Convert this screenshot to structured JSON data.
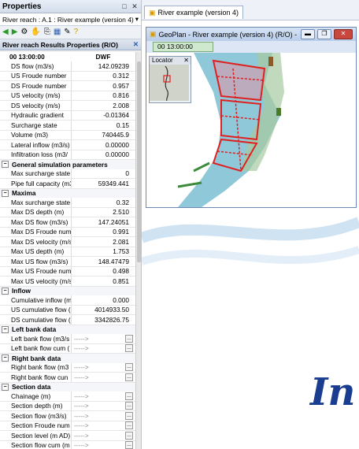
{
  "panel": {
    "title": "Properties",
    "pin": "□",
    "close": "✕",
    "object": "River reach : A.1 : River example (version 4)",
    "results_title": "River reach Results Properties (R/O)"
  },
  "toolbar_icons": [
    "back-arrow-icon",
    "forward-arrow-icon",
    "settings-icon",
    "pointer-icon",
    "copy-icon",
    "grid-icon",
    "paint-icon",
    "help-icon"
  ],
  "grid": {
    "time": "00 13:00:00",
    "scenario": "DWF"
  },
  "rows_top": [
    {
      "name": "DS flow (m3/s)",
      "value": "142.09239"
    },
    {
      "name": "US Froude number",
      "value": "0.312"
    },
    {
      "name": "DS Froude number",
      "value": "0.957"
    },
    {
      "name": "US velocity (m/s)",
      "value": "0.816"
    },
    {
      "name": "DS velocity (m/s)",
      "value": "2.008"
    },
    {
      "name": "Hydraulic gradient",
      "value": "-0.01364"
    },
    {
      "name": "Surcharge state",
      "value": "0.15"
    },
    {
      "name": "Volume (m3)",
      "value": "740445.9"
    },
    {
      "name": "Lateral inflow (m3/s)",
      "value": "0.00000"
    },
    {
      "name": "Infiltration loss (m3/",
      "value": "0.00000"
    }
  ],
  "sections": [
    {
      "title": "General simulation parameters",
      "rows": [
        {
          "name": "Max surcharge state",
          "value": "0"
        },
        {
          "name": "Pipe full capacity (m3",
          "value": "59349.441"
        }
      ]
    },
    {
      "title": "Maxima",
      "rows": [
        {
          "name": "Max surcharge state",
          "value": "0.32"
        },
        {
          "name": "Max DS depth (m)",
          "value": "2.510"
        },
        {
          "name": "Max DS flow (m3/s)",
          "value": "147.24051"
        },
        {
          "name": "Max DS Froude num",
          "value": "0.991"
        },
        {
          "name": "Max DS velocity (m/s",
          "value": "2.081"
        },
        {
          "name": "Max US depth (m)",
          "value": "1.753"
        },
        {
          "name": "Max US flow (m3/s)",
          "value": "148.47479"
        },
        {
          "name": "Max US Froude num",
          "value": "0.498"
        },
        {
          "name": "Max US velocity (m/s",
          "value": "0.851"
        }
      ]
    },
    {
      "title": "Inflow",
      "rows": [
        {
          "name": "Cumulative inflow (m",
          "value": "0.000"
        },
        {
          "name": "US cumulative flow (",
          "value": "4014933.50"
        },
        {
          "name": "DS cumulative flow (",
          "value": "3342826.75"
        }
      ]
    },
    {
      "title": "Left bank data",
      "rows": [
        {
          "name": "Left bank flow (m3/s",
          "value": "----->",
          "empty": true
        },
        {
          "name": "Left bank flow cum (",
          "value": "----->",
          "empty": true
        }
      ]
    },
    {
      "title": "Right bank data",
      "rows": [
        {
          "name": "Right bank flow (m3",
          "value": "----->",
          "empty": true
        },
        {
          "name": "Right bank flow cun",
          "value": "----->",
          "empty": true
        }
      ]
    },
    {
      "title": "Section data",
      "rows": [
        {
          "name": "Chainage (m)",
          "value": "----->",
          "empty": true
        },
        {
          "name": "Section depth (m)",
          "value": "----->",
          "empty": true
        },
        {
          "name": "Section flow (m3/s)",
          "value": "----->",
          "empty": true
        },
        {
          "name": "Section Froude num",
          "value": "----->",
          "empty": true
        },
        {
          "name": "Section level (m AD)",
          "value": "----->",
          "empty": true
        },
        {
          "name": "Section flow cum (m",
          "value": "----->",
          "empty": true
        },
        {
          "name": "Section velocity (m/s",
          "value": "----->",
          "empty": true
        }
      ]
    }
  ],
  "doc_tab": "River example (version 4)",
  "geoplan": {
    "title": "GeoPlan - River example (version 4) (R/O) - ...",
    "time": "00 13:00:00",
    "locator": "Locator"
  },
  "brand_text": "In"
}
